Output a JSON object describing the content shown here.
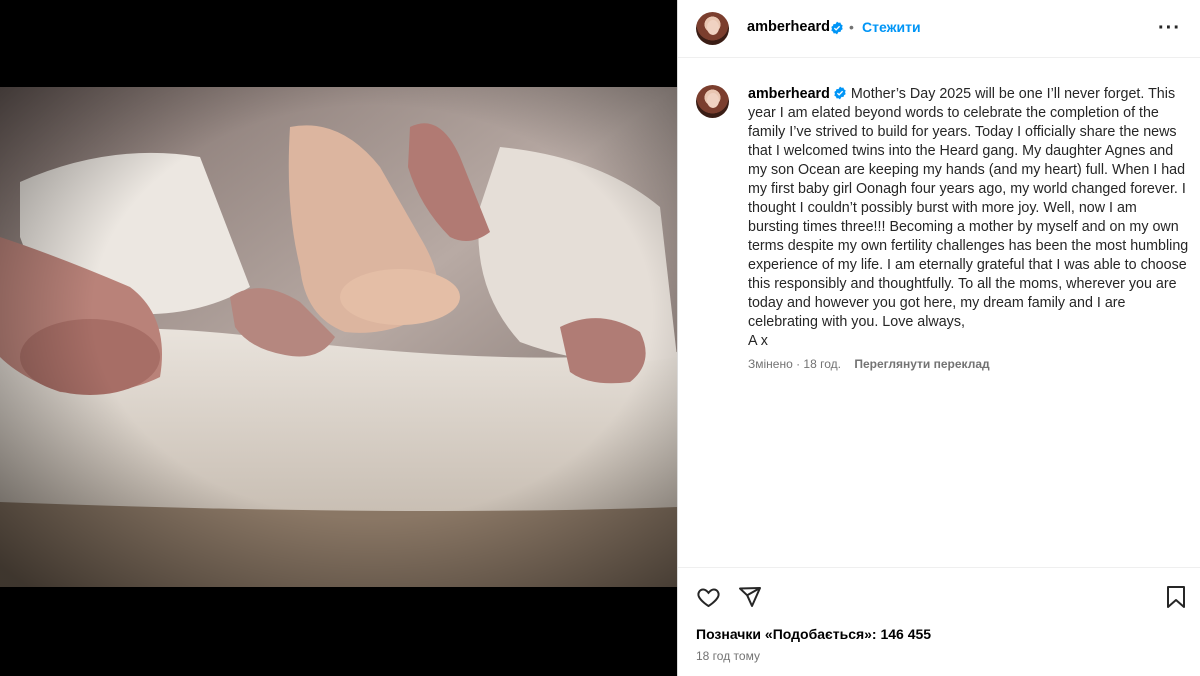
{
  "post": {
    "username": "amberheard",
    "separator": "•",
    "follow_label": "Стежити",
    "more_label": "···",
    "caption_user": "amberheard",
    "caption_text": "Mother’s Day 2025 will be one I’ll never forget. This year I am elated beyond words to celebrate the completion of the family I’ve strived to build for years. Today I officially share the news that I welcomed twins into the Heard gang. My daughter Agnes and my son Ocean are keeping my hands (and my heart) full. When I had my first baby girl Oonagh four years ago, my world changed forever. I thought I couldn’t possibly burst with more joy. Well, now I am bursting times three!!! Becoming a mother by myself and on my own terms despite my own fertility challenges has been the most humbling experience of my life. I am eternally grateful that I was able to choose this responsibly and thoughtfully. To all the moms, wherever you are today and however you got here, my dream family and I are celebrating with you. Love always,\nA x",
    "edited_label": "Змінено · 18 год.",
    "translate_label": "Переглянути переклад",
    "likes_text": "Позначки «Подобається»: 146 455",
    "timestamp": "18 год тому"
  },
  "icons": {
    "verified": "verified-badge-icon",
    "like": "heart-outline-icon",
    "share": "paper-plane-icon",
    "save": "bookmark-icon"
  },
  "colors": {
    "link_blue": "#0095f6",
    "verified_blue": "#0095f6",
    "text_dark": "#262626",
    "text_muted": "#737373",
    "border": "#dbdbdb"
  }
}
